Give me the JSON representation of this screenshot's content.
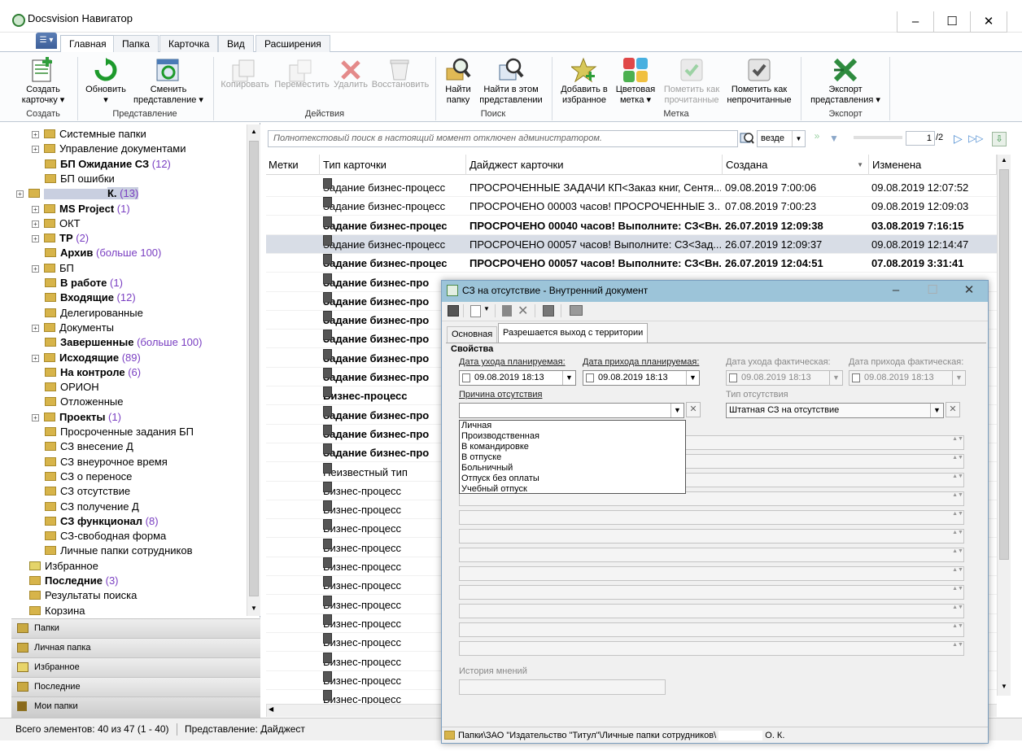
{
  "window": {
    "title": "Docsvision Навигатор",
    "min": "–",
    "max": "☐",
    "close": "✕"
  },
  "ribbon_tabs": [
    "Главная",
    "Папка",
    "Карточка",
    "Вид",
    "Расширения"
  ],
  "ribbon": {
    "create": {
      "label": "Создать\nкарточку ▾",
      "group": "Создать"
    },
    "refresh": {
      "label": "Обновить\n▾"
    },
    "change_view": {
      "label": "Сменить\nпредставление ▾"
    },
    "view_group": "Представление",
    "copy": "Копировать",
    "move": "Переместить",
    "delete": "Удалить",
    "restore": "Восстановить",
    "actions_group": "Действия",
    "find_folder": "Найти\nпапку",
    "find_view": "Найти в этом\nпредставлении",
    "search_group": "Поиск",
    "add_fav": "Добавить в\nизбранное",
    "color_mark": "Цветовая\nметка ▾",
    "mark_read": "Пометить как\nпрочитанные",
    "mark_unread": "Пометить как\nнепрочитанные",
    "mark_group": "Метка",
    "export": "Экспорт\nпредставления ▾",
    "export_group": "Экспорт"
  },
  "tree": [
    {
      "label": "Системные папки",
      "exp": true,
      "bold": false,
      "count": "",
      "indent": 1
    },
    {
      "label": "Управление документами",
      "exp": true,
      "bold": false,
      "count": "",
      "indent": 1
    },
    {
      "label": "БП Ожидание СЗ",
      "exp": false,
      "bold": true,
      "count": "(12)",
      "indent": 1
    },
    {
      "label": "БП ошибки",
      "exp": false,
      "bold": false,
      "count": "",
      "indent": 1
    },
    {
      "label": "К.",
      "exp": true,
      "bold": true,
      "count": "(13)",
      "indent": 0,
      "highlight": true
    },
    {
      "label": "MS Project",
      "exp": true,
      "bold": true,
      "count": "(1)",
      "indent": 1
    },
    {
      "label": "ОКТ",
      "exp": true,
      "bold": false,
      "count": "",
      "indent": 1
    },
    {
      "label": "ТР",
      "exp": true,
      "bold": true,
      "count": "(2)",
      "indent": 1
    },
    {
      "label": "Архив",
      "exp": false,
      "bold": true,
      "count": "(больше 100)",
      "indent": 1
    },
    {
      "label": "БП",
      "exp": true,
      "bold": false,
      "count": "",
      "indent": 1
    },
    {
      "label": "В работе",
      "exp": false,
      "bold": true,
      "count": "(1)",
      "indent": 1
    },
    {
      "label": "Входящие",
      "exp": false,
      "bold": true,
      "count": "(12)",
      "indent": 1
    },
    {
      "label": "Делегированные",
      "exp": false,
      "bold": false,
      "count": "",
      "indent": 1
    },
    {
      "label": "Документы",
      "exp": true,
      "bold": false,
      "count": "",
      "indent": 1
    },
    {
      "label": "Завершенные",
      "exp": false,
      "bold": true,
      "count": "(больше 100)",
      "indent": 1
    },
    {
      "label": "Исходящие",
      "exp": true,
      "bold": true,
      "count": "(89)",
      "indent": 1
    },
    {
      "label": "На контроле",
      "exp": false,
      "bold": true,
      "count": "(6)",
      "indent": 1
    },
    {
      "label": "ОРИОН",
      "exp": false,
      "bold": false,
      "count": "",
      "indent": 1
    },
    {
      "label": "Отложенные",
      "exp": false,
      "bold": false,
      "count": "",
      "indent": 1
    },
    {
      "label": "Проекты",
      "exp": true,
      "bold": true,
      "count": "(1)",
      "indent": 1
    },
    {
      "label": "Просроченные задания БП",
      "exp": false,
      "bold": false,
      "count": "",
      "indent": 1
    },
    {
      "label": "СЗ внесение Д",
      "exp": false,
      "bold": false,
      "count": "",
      "indent": 1
    },
    {
      "label": "СЗ внеурочное время",
      "exp": false,
      "bold": false,
      "count": "",
      "indent": 1
    },
    {
      "label": "СЗ о переносе",
      "exp": false,
      "bold": false,
      "count": "",
      "indent": 1
    },
    {
      "label": "СЗ отсутствие",
      "exp": false,
      "bold": false,
      "count": "",
      "indent": 1
    },
    {
      "label": "СЗ получение Д",
      "exp": false,
      "bold": false,
      "count": "",
      "indent": 1
    },
    {
      "label": "СЗ функционал",
      "exp": false,
      "bold": true,
      "count": "(8)",
      "indent": 1
    },
    {
      "label": "СЗ-свободная форма",
      "exp": false,
      "bold": false,
      "count": "",
      "indent": 1
    },
    {
      "label": "Личные папки сотрудников",
      "exp": false,
      "bold": false,
      "count": "",
      "indent": 1
    },
    {
      "label": "Избранное",
      "exp": false,
      "bold": false,
      "count": "",
      "indent": 0,
      "star": true
    },
    {
      "label": "Последние",
      "exp": false,
      "bold": true,
      "count": "(3)",
      "indent": 0
    },
    {
      "label": "Результаты поиска",
      "exp": false,
      "bold": false,
      "count": "",
      "indent": 0
    },
    {
      "label": "Корзина",
      "exp": false,
      "bold": false,
      "count": "",
      "indent": 0
    }
  ],
  "nav_buttons": [
    "Папки",
    "Личная папка",
    "Избранное",
    "Последние",
    "Мои папки"
  ],
  "status": {
    "total": "Всего элементов: 40 из 47 (1 - 40)",
    "view": "Представление: Дайджест"
  },
  "search": {
    "placeholder": "Полнотекстовый поиск в настоящий момент отключен администратором.",
    "scope": "везде",
    "page": "1",
    "pages": "/2"
  },
  "grid": {
    "headers": [
      "Метки",
      "Тип карточки",
      "Дайджест карточки",
      "Создана",
      "Изменена"
    ],
    "rows": [
      {
        "type": "Задание бизнес-процесс",
        "digest": "ПРОСРОЧЕННЫЕ ЗАДАЧИ КП<Заказ книг, Сентя...",
        "created": "09.08.2019 7:00:06",
        "changed": "09.08.2019 12:07:52",
        "bold": false
      },
      {
        "type": "Задание бизнес-процесс",
        "digest": "ПРОСРОЧЕНО 00003 часов! ПРОСРОЧЕННЫЕ З...",
        "created": "07.08.2019 7:00:23",
        "changed": "09.08.2019 12:09:03",
        "bold": false
      },
      {
        "type": "Задание бизнес-процес",
        "digest": "ПРОСРОЧЕНО 00040 часов! Выполните: СЗ<Вн...",
        "created": "26.07.2019 12:09:38",
        "changed": "03.08.2019 7:16:15",
        "bold": true
      },
      {
        "type": "Задание бизнес-процесс",
        "digest": "ПРОСРОЧЕНО 00057 часов! Выполните: СЗ<Зад...",
        "created": "26.07.2019 12:09:37",
        "changed": "09.08.2019 12:14:47",
        "bold": false,
        "sel": true
      },
      {
        "type": "Задание бизнес-процес",
        "digest": "ПРОСРОЧЕНО 00057 часов! Выполните: СЗ<Вн...",
        "created": "26.07.2019 12:04:51",
        "changed": "07.08.2019 3:31:41",
        "bold": true
      },
      {
        "type": "Задание бизнес-про",
        "digest": "",
        "created": "",
        "changed": "",
        "bold": true
      },
      {
        "type": "Задание бизнес-про",
        "digest": "",
        "created": "",
        "changed": "",
        "bold": true
      },
      {
        "type": "Задание бизнес-про",
        "digest": "",
        "created": "",
        "changed": "",
        "bold": true
      },
      {
        "type": "Задание бизнес-про",
        "digest": "",
        "created": "",
        "changed": "",
        "bold": true
      },
      {
        "type": "Задание бизнес-про",
        "digest": "",
        "created": "",
        "changed": "",
        "bold": true
      },
      {
        "type": "Задание бизнес-про",
        "digest": "",
        "created": "",
        "changed": "",
        "bold": true
      },
      {
        "type": "Бизнес-процесс",
        "digest": "",
        "created": "",
        "changed": "",
        "bold": true
      },
      {
        "type": "Задание бизнес-про",
        "digest": "",
        "created": "",
        "changed": "",
        "bold": true
      },
      {
        "type": "Задание бизнес-про",
        "digest": "",
        "created": "",
        "changed": "",
        "bold": true
      },
      {
        "type": "Задание бизнес-про",
        "digest": "",
        "created": "",
        "changed": "",
        "bold": true
      },
      {
        "type": "Неизвестный тип",
        "digest": "",
        "created": "",
        "changed": "",
        "bold": false
      },
      {
        "type": "Бизнес-процесс",
        "digest": "",
        "created": "",
        "changed": "",
        "bold": false
      },
      {
        "type": "Бизнес-процесс",
        "digest": "",
        "created": "",
        "changed": "",
        "bold": false
      },
      {
        "type": "Бизнес-процесс",
        "digest": "",
        "created": "",
        "changed": "",
        "bold": false
      },
      {
        "type": "Бизнес-процесс",
        "digest": "",
        "created": "",
        "changed": "",
        "bold": false
      },
      {
        "type": "Бизнес-процесс",
        "digest": "",
        "created": "",
        "changed": "",
        "bold": false
      },
      {
        "type": "Бизнес-процесс",
        "digest": "",
        "created": "",
        "changed": "",
        "bold": false
      },
      {
        "type": "Бизнес-процесс",
        "digest": "",
        "created": "",
        "changed": "",
        "bold": false
      },
      {
        "type": "Бизнес-процесс",
        "digest": "",
        "created": "",
        "changed": "",
        "bold": false
      },
      {
        "type": "Бизнес-процесс",
        "digest": "",
        "created": "",
        "changed": "",
        "bold": false
      },
      {
        "type": "Бизнес-процесс",
        "digest": "",
        "created": "",
        "changed": "",
        "bold": false
      },
      {
        "type": "Бизнес-процесс",
        "digest": "",
        "created": "",
        "changed": "",
        "bold": false
      },
      {
        "type": "Бизнес-процесс",
        "digest": "",
        "created": "",
        "changed": "",
        "bold": false
      }
    ]
  },
  "dialog": {
    "title": "СЗ на отсутствие - Внутренний документ",
    "tabs": [
      "Основная",
      "Разрешается выход с территории"
    ],
    "section": "Свойства",
    "planned_leave_label": "Дата ухода планируемая:",
    "planned_leave_value": "09.08.2019 18:13",
    "planned_return_label": "Дата прихода планируемая:",
    "planned_return_value": "09.08.2019 18:13",
    "actual_leave_label": "Дата ухода фактическая:",
    "actual_leave_value": "09.08.2019 18:13",
    "actual_return_label": "Дата прихода фактическая:",
    "actual_return_value": "09.08.2019 18:13",
    "reason_label": "Причина отсутствия",
    "reason_value": "",
    "absence_type_label": "Тип отсутствия",
    "absence_type_value": "Штатная СЗ на отсутствие",
    "reason_options": [
      "Личная",
      "Производственная",
      "В командировке",
      "В отпуске",
      "Больничный",
      "Отпуск без оплаты",
      "Учебный отпуск"
    ],
    "history_label": "История мнений",
    "path": "Папки\\ЗАО \"Издательство \"Титул\"\\Личные папки сотрудников\\",
    "path_suffix": "О. К."
  }
}
